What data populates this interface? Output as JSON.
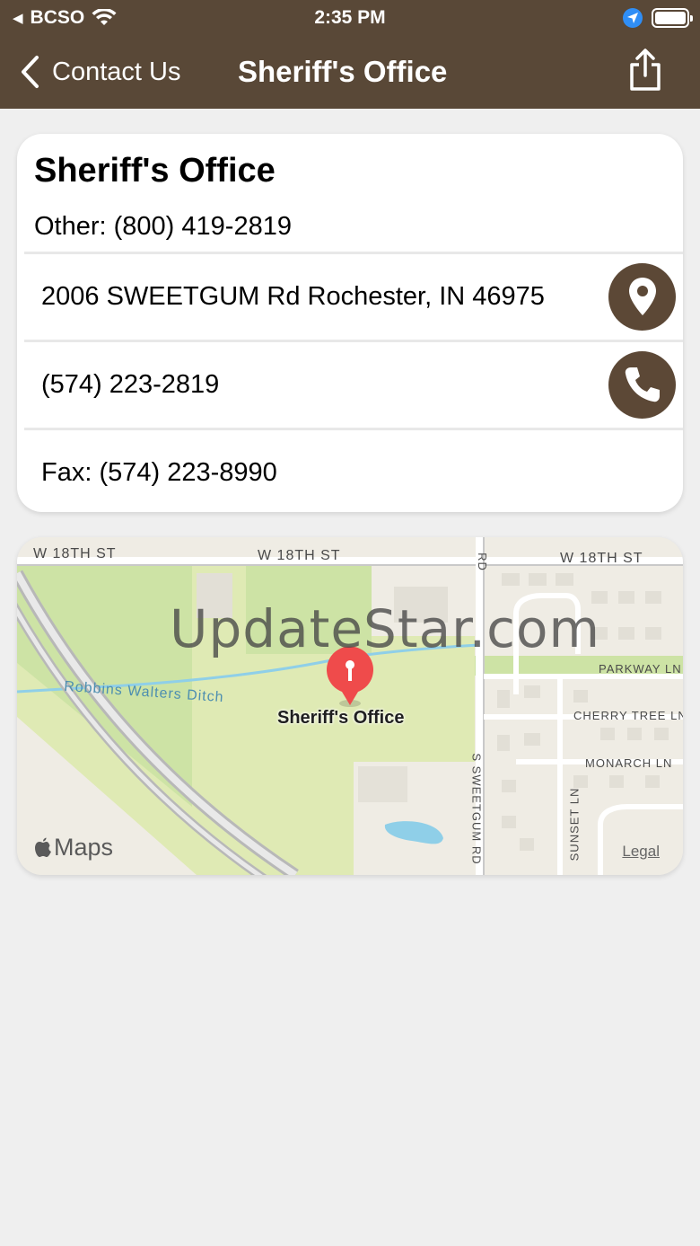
{
  "status_bar": {
    "back_app": "BCSO",
    "time": "2:35 PM"
  },
  "nav": {
    "back_label": "Contact Us",
    "title": "Sheriff's Office"
  },
  "card": {
    "title": "Sheriff's Office",
    "other": "Other: (800) 419-2819",
    "address": "2006 SWEETGUM Rd Rochester, IN 46975",
    "phone": "(574) 223-2819",
    "fax": "Fax: (574) 223-8990"
  },
  "map": {
    "watermark": "UpdateStar.com",
    "pin_label": "Sheriff's Office",
    "streets": {
      "w18_left": "W 18TH ST",
      "w18_mid": "W 18TH ST",
      "w18_right": "W 18TH ST",
      "parkway": "PARKWAY LN",
      "cherry": "CHERRY TREE LN",
      "monarch": "MONARCH LN",
      "sweetgum": "S SWEETGUM RD",
      "sunset": "SUNSET LN",
      "rd_top": "RD",
      "ditch": "Robbins Walters Ditch"
    },
    "logo": "Maps",
    "legal": "Legal"
  },
  "colors": {
    "nav_bg": "#594837",
    "action_bg": "#5c4836",
    "pin": "#ef4b4b",
    "location_blue": "#2f8ef6"
  },
  "icons": {
    "back": "chevron-left-icon",
    "share": "share-icon",
    "location": "map-pin-icon",
    "phone": "phone-icon"
  }
}
